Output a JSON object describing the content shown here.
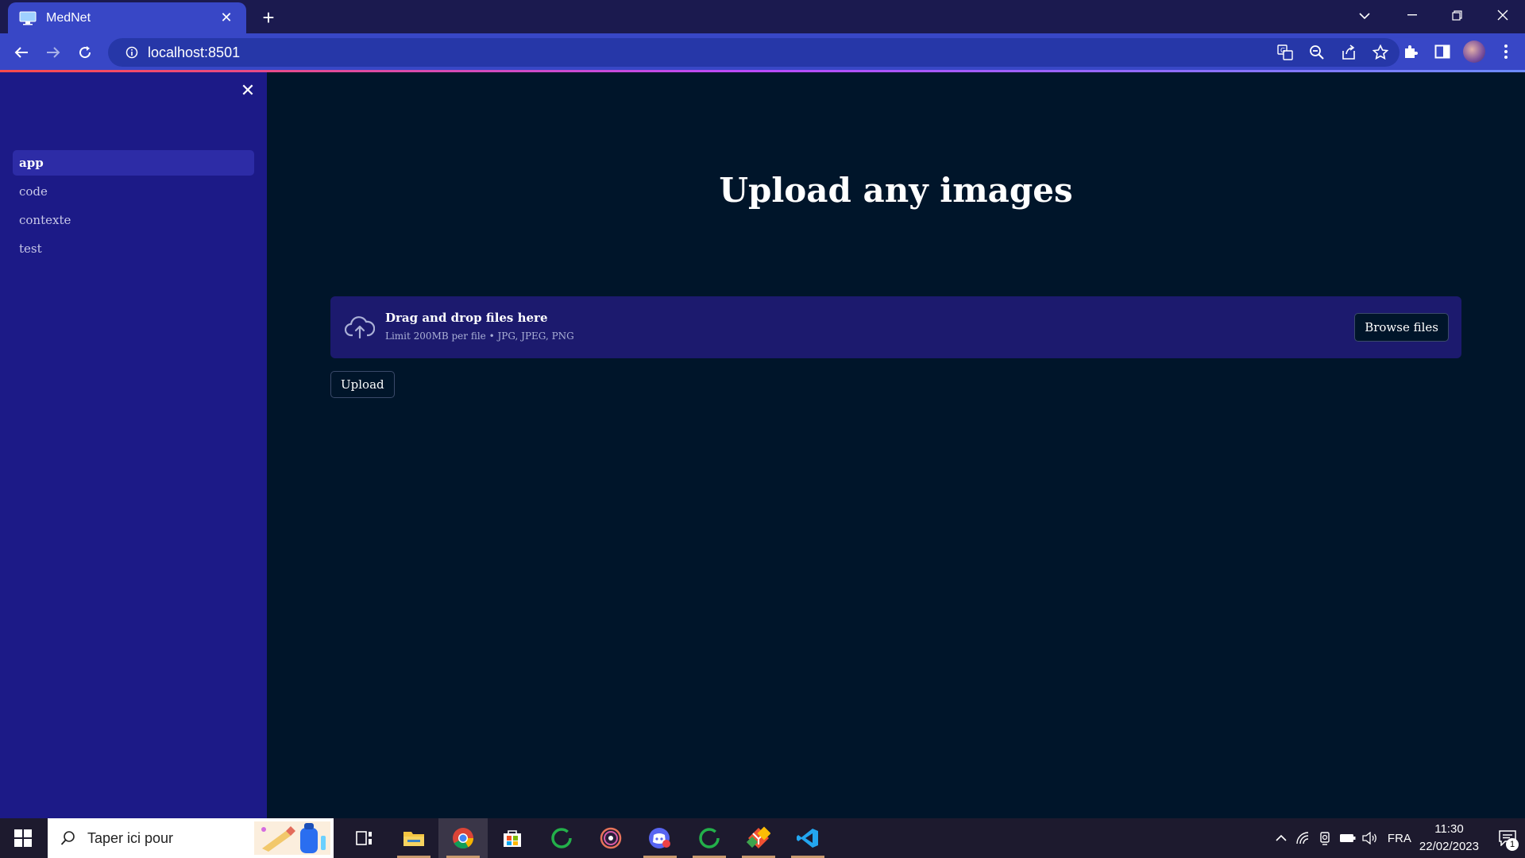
{
  "browser": {
    "tab_title": "MedNet",
    "new_tab_symbol": "+",
    "url": "localhost:8501",
    "window_controls": [
      "minimize-icon",
      "restore-icon",
      "close-icon"
    ],
    "omnibox_icons": [
      "translate-icon",
      "zoom-out-icon",
      "share-icon",
      "star-icon"
    ],
    "toolbar_icons": [
      "extensions-icon",
      "side-panel-icon",
      "profile-avatar",
      "menu-icon"
    ]
  },
  "sidebar": {
    "close_symbol": "✕",
    "items": [
      {
        "label": "app",
        "active": true
      },
      {
        "label": "code",
        "active": false
      },
      {
        "label": "contexte",
        "active": false
      },
      {
        "label": "test",
        "active": false
      }
    ]
  },
  "main": {
    "title": "Upload any images",
    "dropzone": {
      "main_text": "Drag and drop files here",
      "sub_text": "Limit 200MB per file • JPG, JPEG, PNG",
      "browse_label": "Browse files",
      "icon": "cloud-upload-icon"
    },
    "upload_label": "Upload"
  },
  "taskbar": {
    "search_placeholder": "Taper ici pour",
    "apps": [
      "task-view-icon",
      "file-explorer-icon",
      "chrome-icon",
      "ms-store-icon",
      "green-ring-app-icon",
      "media-player-icon",
      "discord-icon",
      "green-ring-app-2-icon",
      "git-icon",
      "vscode-icon"
    ],
    "language": "FRA",
    "time": "11:30",
    "date": "22/02/2023",
    "notification_count": "1"
  },
  "colors": {
    "tab_active": "#3847c6",
    "sidebar_bg": "#1c1a87",
    "main_bg": "#00152a",
    "dropzone_bg": "#1c1a6e"
  }
}
